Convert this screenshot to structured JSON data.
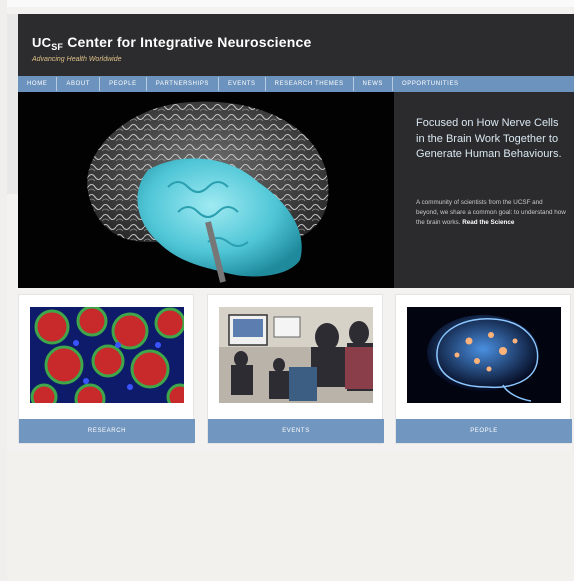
{
  "header": {
    "logo_mark": "UC",
    "logo_mark_sub": "SF",
    "site_title": "Center for Integrative Neuroscience",
    "tagline": "Advancing Health Worldwide"
  },
  "nav": {
    "items": [
      "HOME",
      "ABOUT",
      "PEOPLE",
      "PARTNERSHIPS",
      "EVENTS",
      "RESEARCH THEMES",
      "NEWS",
      "OPPORTUNITIES"
    ]
  },
  "hero": {
    "title": "Focused on How Nerve Cells in the Brain Work Together to Generate Human Behaviours.",
    "text": "A community of scientists from the UCSF and beyond, we share a common goal: to understand how the brain works.",
    "link_label": "Read the Science"
  },
  "cards": [
    {
      "button": "RESEARCH",
      "image": "cell-microscopy-image"
    },
    {
      "button": "EVENTS",
      "image": "seminar-photo"
    },
    {
      "button": "PEOPLE",
      "image": "glowing-brain-image"
    }
  ],
  "colors": {
    "header_bg": "#2c2c2e",
    "nav_bg": "#6c93bd",
    "button_bg": "#7196bf",
    "hero_panel_bg": "#2b2b2d",
    "brain_highlight": "#4fc6d6"
  }
}
